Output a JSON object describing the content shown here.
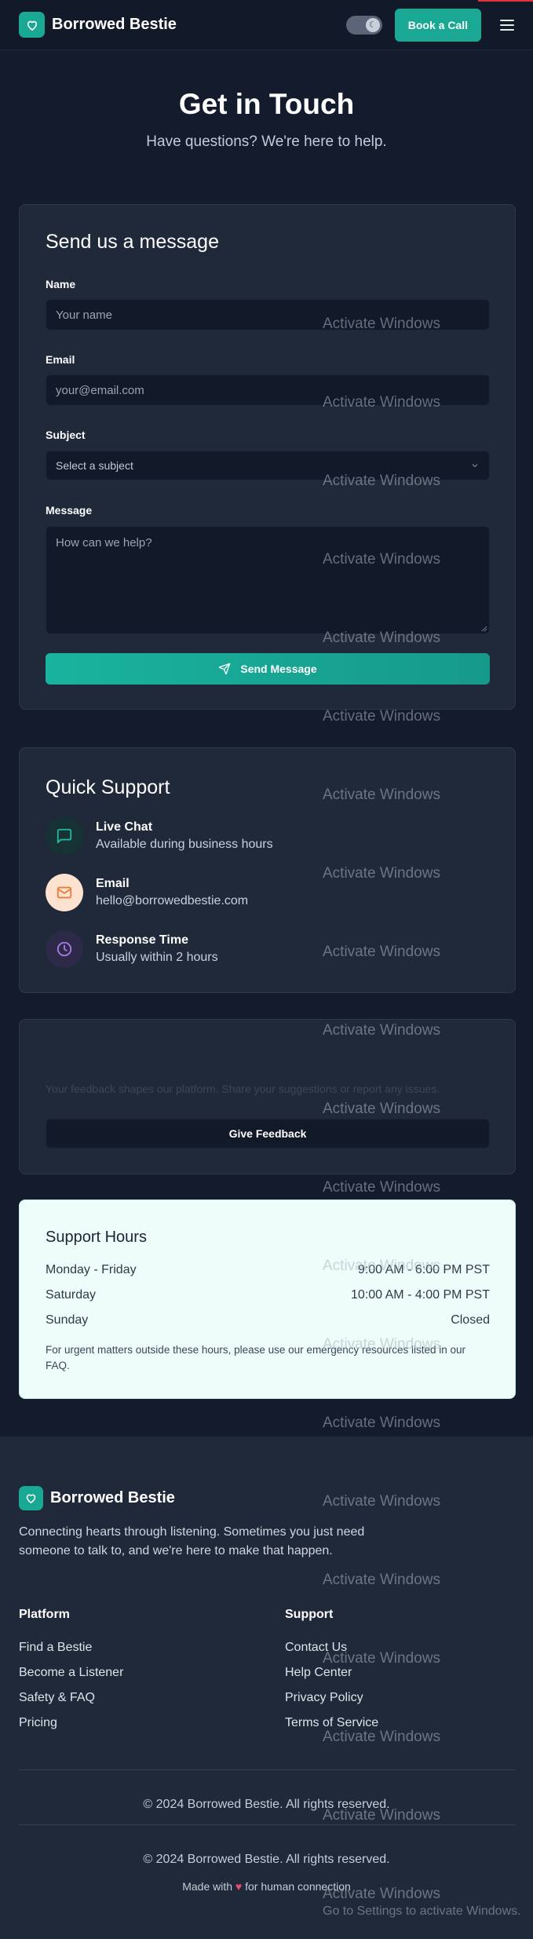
{
  "header": {
    "brand": "Borrowed Bestie",
    "book_label": "Book a Call"
  },
  "hero": {
    "title": "Get in Touch",
    "subtitle": "Have questions? We're here to help."
  },
  "form": {
    "title": "Send us a message",
    "name_label": "Name",
    "name_placeholder": "Your name",
    "email_label": "Email",
    "email_placeholder": "your@email.com",
    "subject_label": "Subject",
    "subject_value": "Select a subject",
    "message_label": "Message",
    "message_placeholder": "How can we help?",
    "send_label": "Send Message"
  },
  "quick_support": {
    "title": "Quick Support",
    "items": [
      {
        "title": "Live Chat",
        "sub": "Available during business hours",
        "icon": "chat-icon"
      },
      {
        "title": "Email",
        "sub": "hello@borrowedbestie.com",
        "icon": "mail-icon"
      },
      {
        "title": "Response Time",
        "sub": "Usually within 2 hours",
        "icon": "clock-icon"
      }
    ]
  },
  "feedback": {
    "text": "Your feedback shapes our platform. Share your suggestions or report any issues.",
    "button": "Give Feedback"
  },
  "hours": {
    "title": "Support Hours",
    "rows": [
      {
        "day": "Monday - Friday",
        "time": "9:00 AM - 6:00 PM PST"
      },
      {
        "day": "Saturday",
        "time": "10:00 AM - 4:00 PM PST"
      },
      {
        "day": "Sunday",
        "time": "Closed"
      }
    ],
    "note": "For urgent matters outside these hours, please use our emergency resources listed in our FAQ."
  },
  "footer": {
    "brand": "Borrowed Bestie",
    "description": "Connecting hearts through listening. Sometimes you just need someone to talk to, and we're here to make that happen.",
    "platform_title": "Platform",
    "platform_links": [
      "Find a Bestie",
      "Become a Listener",
      "Safety & FAQ",
      "Pricing"
    ],
    "support_title": "Support",
    "support_links": [
      "Contact Us",
      "Help Center",
      "Privacy Policy",
      "Terms of Service"
    ],
    "copyright_1": "© 2024 Borrowed Bestie. All rights reserved.",
    "copyright_2": "© 2024 Borrowed Bestie. All rights reserved.",
    "made_prefix": "Made with",
    "made_suffix": "for human connection"
  },
  "watermark": {
    "text": "Activate Windows",
    "sub": "Go to Settings to activate Windows."
  },
  "colors": {
    "accent": "#18a894",
    "background": "#131b2c",
    "card": "#1f2939",
    "hours_card": "#ecfdfa"
  }
}
